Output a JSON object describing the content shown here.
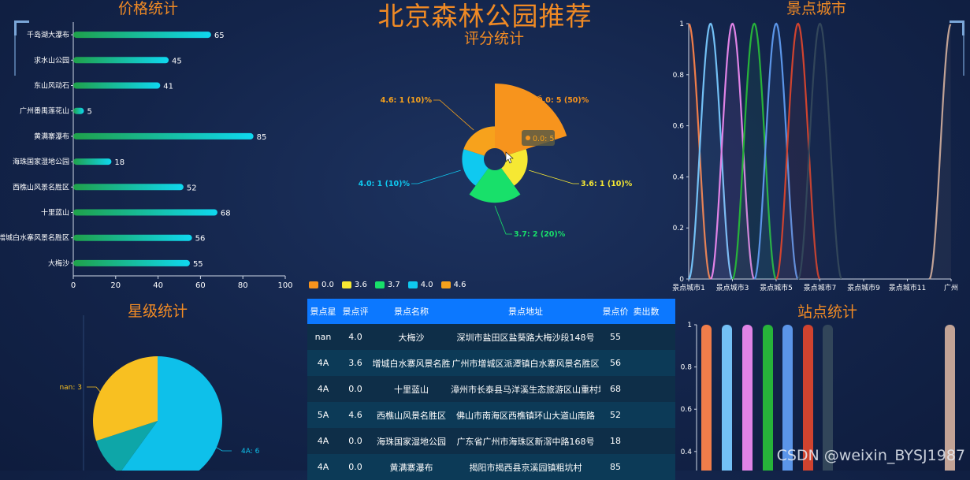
{
  "page": {
    "title": "北京森林公园推荐",
    "watermark": "CSDN @weixin_BYSJ1987"
  },
  "panels": {
    "price": "价格统计",
    "rating": "评分统计",
    "city": "景点城市",
    "star": "星级统计",
    "station": "站点统计"
  },
  "price_chart": {
    "type": "bar",
    "categories": [
      "千岛湖大瀑布",
      "求水山公园",
      "东山风动石",
      "广州番禺莲花山",
      "黄满寨瀑布",
      "海珠国家湿地公园",
      "西樵山风景名胜区",
      "十里蓝山",
      "增城白水寨风景名胜区",
      "大梅沙"
    ],
    "values": [
      65,
      45,
      41,
      5,
      85,
      18,
      52,
      68,
      56,
      55
    ],
    "xlim": [
      0,
      100
    ],
    "xticks": [
      "0",
      "20",
      "40",
      "60",
      "80",
      "100"
    ],
    "colors": {
      "start": "#1fa14a",
      "end": "#0fd8f0"
    }
  },
  "rating_chart": {
    "type": "pie",
    "labels": [
      "0.0",
      "3.6",
      "3.7",
      "4.0",
      "4.6"
    ],
    "values": [
      5,
      1,
      2,
      1,
      1
    ],
    "slice_labels": [
      "0.0: 5 (50)%",
      "3.6: 1 (10)%",
      "3.7: 2 (20)%",
      "4.0: 1 (10)%",
      "4.6: 1 (10)%"
    ],
    "colors": [
      "#f7941d",
      "#f6e833",
      "#18e06a",
      "#0fc9f0",
      "#f7a21c"
    ],
    "tooltip": "0.0: 5"
  },
  "city_chart": {
    "type": "line",
    "yticks": [
      "0",
      "0.2",
      "0.4",
      "0.6",
      "0.8",
      "1"
    ],
    "xticks": [
      "景点城市1",
      "景点城市3",
      "景点城市5",
      "景点城市7",
      "景点城市9",
      "景点城市11",
      "广州"
    ],
    "series_colors": [
      "#f07d4a",
      "#73c0f5",
      "#e083e6",
      "#27b33a",
      "#5b95e8",
      "#d0432f",
      "#32465a",
      "#c2a396"
    ],
    "ylim": [
      0,
      1
    ]
  },
  "star_chart": {
    "type": "pie",
    "labels": [
      "nan: 3",
      "4A: 6"
    ],
    "values": [
      3,
      6,
      1
    ],
    "colors": [
      "#f8c021",
      "#0ec0ea",
      "#0ea6a8"
    ]
  },
  "station_chart": {
    "type": "bar",
    "yticks": [
      "1",
      "0.8",
      "0.6",
      "0.4"
    ],
    "bar_colors": [
      "#f07d4a",
      "#73c0f5",
      "#e083e6",
      "#27b33a",
      "#5b95e8",
      "#d0432f",
      "#32465a",
      "#c2a396"
    ]
  },
  "table": {
    "headers": [
      "景点星",
      "景点评",
      "景点名称",
      "景点地址",
      "景点价",
      "卖出数"
    ],
    "rows": [
      [
        "nan",
        "4.0",
        "大梅沙",
        "深圳市盐田区盐葵路大梅沙段148号",
        "55",
        ""
      ],
      [
        "4A",
        "3.6",
        "增城白水寨风景名胜",
        "广州市增城区派潭镇白水寨风景名胜区",
        "56",
        ""
      ],
      [
        "4A",
        "0.0",
        "十里蓝山",
        "漳州市长泰县马洋溪生态旅游区山重村境内",
        "68",
        ""
      ],
      [
        "5A",
        "4.6",
        "西樵山风景名胜区",
        "佛山市南海区西樵镇环山大道山南路",
        "52",
        ""
      ],
      [
        "4A",
        "0.0",
        "海珠国家湿地公园",
        "广东省广州市海珠区新滘中路168号",
        "18",
        ""
      ],
      [
        "4A",
        "0.0",
        "黄满寨瀑布",
        "揭阳市揭西县京溪园镇粗坑村",
        "85",
        ""
      ]
    ]
  }
}
